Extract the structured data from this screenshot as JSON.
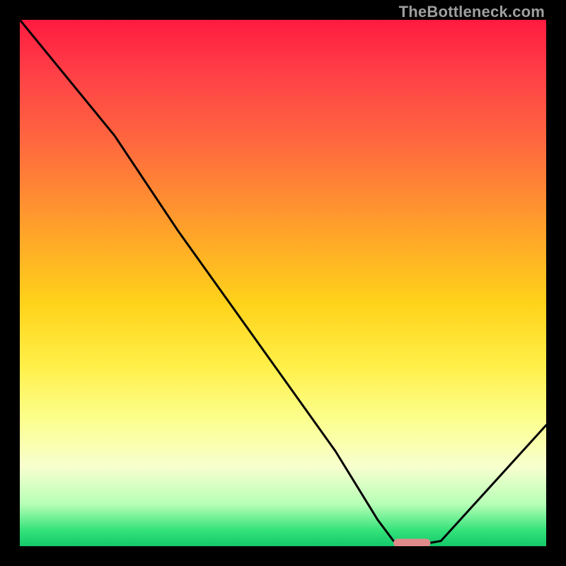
{
  "watermark": "TheBottleneck.com",
  "chart_data": {
    "type": "line",
    "title": "",
    "xlabel": "",
    "ylabel": "",
    "xlim": [
      0,
      100
    ],
    "ylim": [
      0,
      100
    ],
    "series": [
      {
        "name": "bottleneck-curve",
        "x": [
          0,
          18,
          30,
          40,
          50,
          60,
          68,
          71,
          76,
          80,
          100
        ],
        "y": [
          100,
          78,
          60,
          46,
          32,
          18,
          5,
          1,
          0.3,
          1,
          23
        ]
      }
    ],
    "marker": {
      "name": "optimal-marker",
      "x_start": 71,
      "x_end": 78,
      "y": 0.6,
      "color": "#e08a8a"
    },
    "gradient_stops": [
      {
        "pct": 0,
        "color": "#ff1a40"
      },
      {
        "pct": 24,
        "color": "#ff6a3e"
      },
      {
        "pct": 54,
        "color": "#ffd31a"
      },
      {
        "pct": 76,
        "color": "#fcff8e"
      },
      {
        "pct": 92,
        "color": "#b7ffb7"
      },
      {
        "pct": 100,
        "color": "#14c96a"
      }
    ]
  }
}
